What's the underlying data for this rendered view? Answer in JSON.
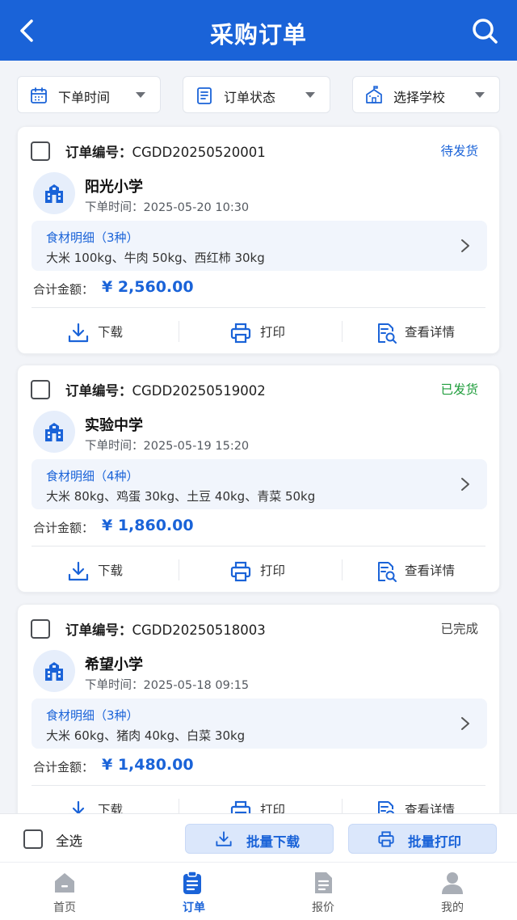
{
  "header": {
    "title": "采购订单",
    "back_icon": "back-arrow-icon",
    "search_icon": "search-icon"
  },
  "filters": [
    {
      "label": "下单时间",
      "icon": "calendar-icon"
    },
    {
      "label": "订单状态",
      "icon": "document-icon"
    },
    {
      "label": "选择学校",
      "icon": "school-icon"
    }
  ],
  "orders": [
    {
      "no_label": "订单编号：",
      "no": "CGDD20250520001",
      "status": "待发货",
      "status_color": "#1a63d8",
      "school": "阳光小学",
      "time": "下单时间：2025-05-20 10:30",
      "detail_title": "食材明细（3种）",
      "detail_items": "大米 100kg、牛肉 50kg、西红柿 30kg",
      "amount_label": "合计金额：",
      "amount": "¥ 2,560.00"
    },
    {
      "no_label": "订单编号：",
      "no": "CGDD20250519002",
      "status": "已发货",
      "status_color": "#1f9d3c",
      "school": "实验中学",
      "time": "下单时间：2025-05-19 15:20",
      "detail_title": "食材明细（4种）",
      "detail_items": "大米 80kg、鸡蛋 30kg、土豆 40kg、青菜 50kg",
      "amount_label": "合计金额：",
      "amount": "¥ 1,860.00"
    },
    {
      "no_label": "订单编号：",
      "no": "CGDD20250518003",
      "status": "已完成",
      "status_color": "#444444",
      "school": "希望小学",
      "time": "下单时间：2025-05-18 09:15",
      "detail_title": "食材明细（3种）",
      "detail_items": "大米 60kg、猪肉 40kg、白菜 30kg",
      "amount_label": "合计金额：",
      "amount": "¥ 1,480.00"
    }
  ],
  "actions": {
    "download": "下载",
    "print": "打印",
    "details": "查看详情"
  },
  "bottom_bar": {
    "select_all": "全选",
    "batch_download": "批量下载",
    "batch_print": "批量打印"
  },
  "tabs": [
    {
      "label": "首页",
      "icon": "home-icon"
    },
    {
      "label": "订单",
      "icon": "order-clipboard-icon",
      "active": true
    },
    {
      "label": "报价",
      "icon": "quote-document-icon"
    },
    {
      "label": "我的",
      "icon": "user-icon"
    }
  ],
  "colors": {
    "primary": "#1a63d8",
    "pending": "#1a63d8",
    "shipped": "#1f9d3c",
    "done": "#444444"
  }
}
